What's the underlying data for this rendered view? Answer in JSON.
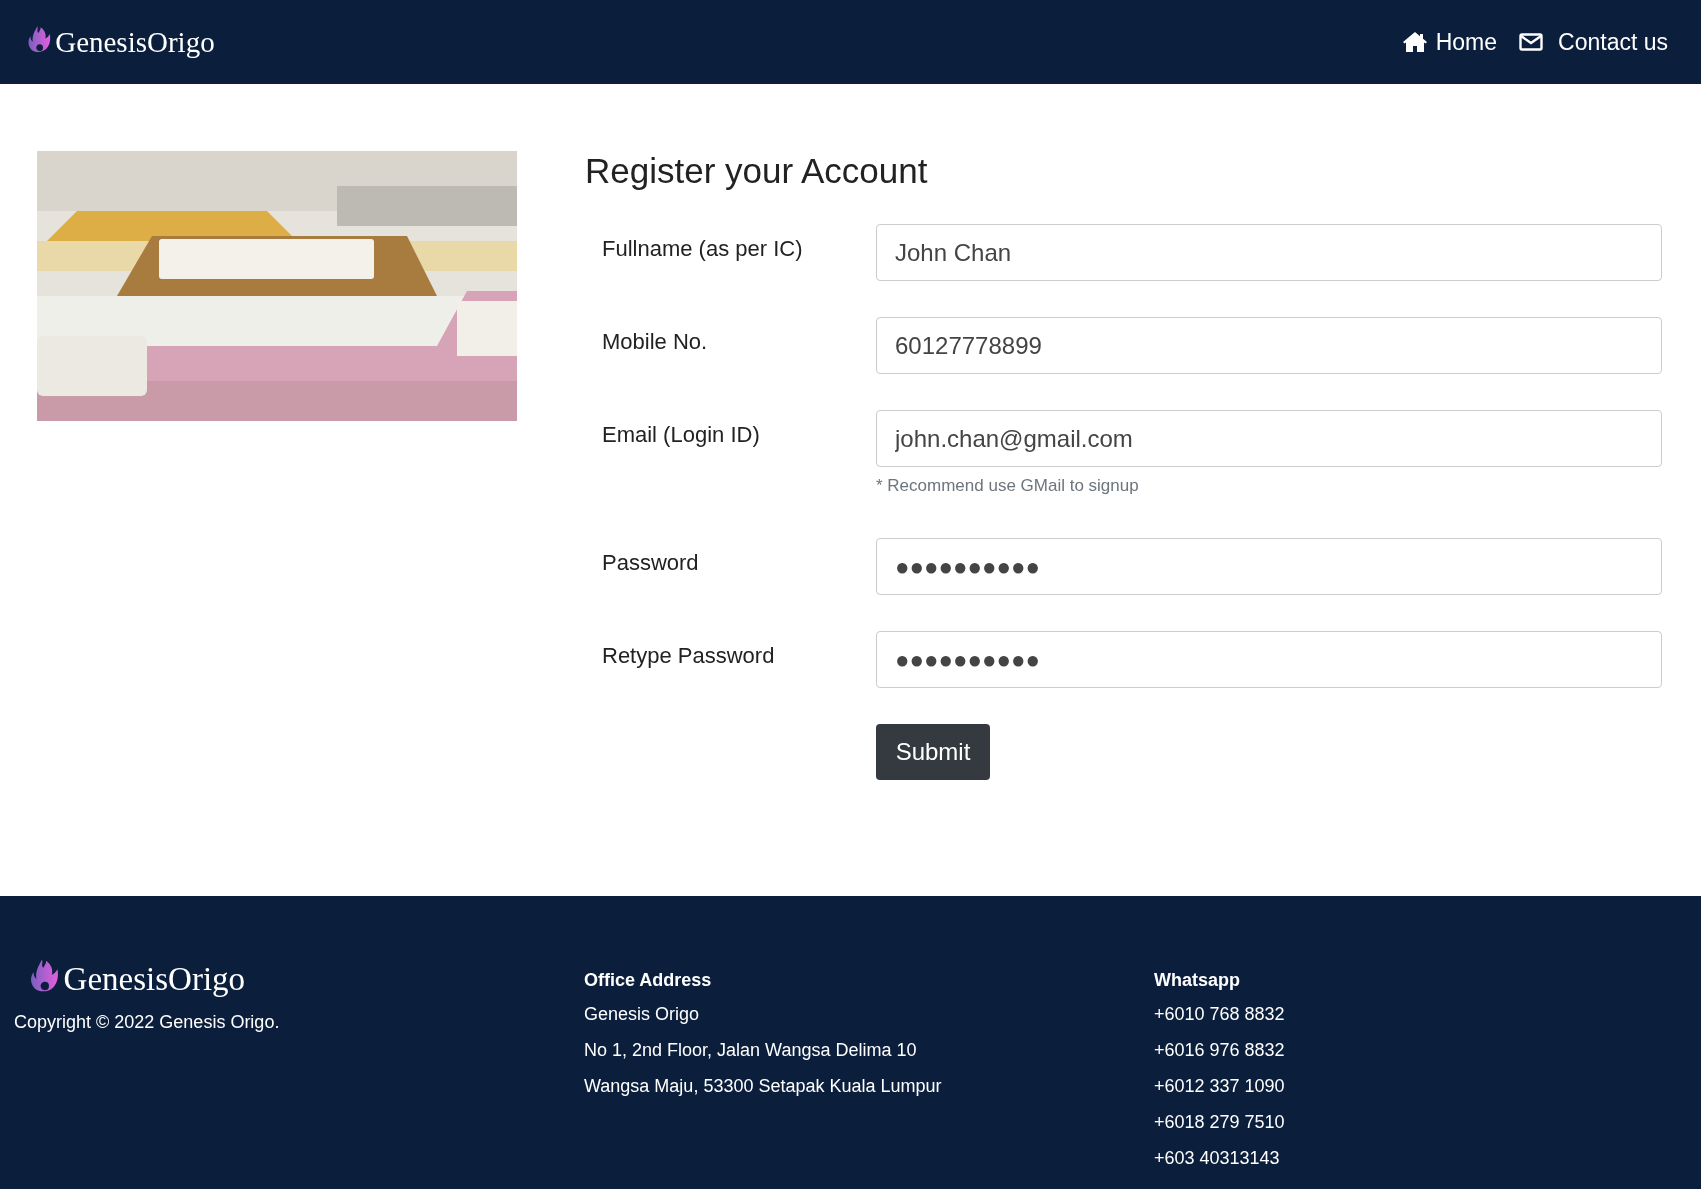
{
  "header": {
    "brand": "GenesisOrigo",
    "nav": [
      {
        "kind": "home",
        "label": "Home"
      },
      {
        "kind": "mail",
        "label": "Contact us"
      }
    ]
  },
  "form": {
    "title": "Register your Account",
    "fields": [
      {
        "label": "Fullname (as per IC)",
        "value": "John Chan"
      },
      {
        "label": "Mobile No.",
        "value": "60127778899"
      },
      {
        "label": "Email (Login ID)",
        "value": "john.chan@gmail.com",
        "hint": "* Recommend use GMail to signup"
      },
      {
        "label": "Password",
        "value": "●●●●●●●●●●"
      },
      {
        "label": "Retype Password",
        "value": "●●●●●●●●●●"
      }
    ],
    "submit": "Submit"
  },
  "footer": {
    "brand": "GenesisOrigo",
    "copyright": "Copyright © 2022 Genesis Origo.",
    "columns": [
      {
        "heading": "Office Address",
        "lines": [
          "Genesis Origo",
          "No 1, 2nd Floor, Jalan Wangsa Delima 10",
          "Wangsa Maju, 53300 Setapak Kuala Lumpur"
        ]
      },
      {
        "heading": "Whatsapp",
        "lines": [
          "+6010 768 8832",
          "+6016 976 8832",
          "+6012 337 1090",
          "+6018 279 7510",
          "+603 40313143"
        ]
      }
    ]
  }
}
